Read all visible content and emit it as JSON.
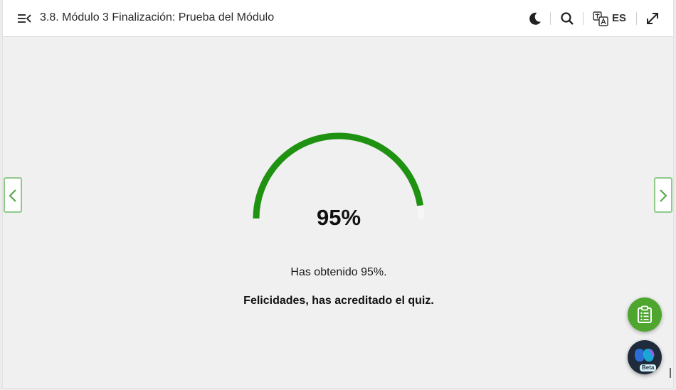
{
  "header": {
    "title": "3.8. Módulo 3 Finalización: Prueba del Módulo",
    "language": "ES"
  },
  "icons": {
    "menu": "menu-collapse-icon",
    "theme": "moon-icon",
    "search": "search-icon",
    "language": "translate-icon",
    "fullscreen": "expand-icon",
    "prev": "chevron-left-icon",
    "next": "chevron-right-icon",
    "fab": "clipboard-list-icon",
    "assistant": "assistant-logo-icon"
  },
  "result": {
    "score_label": "95%",
    "score": 0.95,
    "message": "Has obtenido 95%.",
    "congrats": "Felicidades, has acreditado el quiz."
  },
  "assistant": {
    "badge": "Beta"
  },
  "colors": {
    "accent": "#1f9211",
    "nav_border": "#8fc98b",
    "fab": "#4ea62f"
  }
}
